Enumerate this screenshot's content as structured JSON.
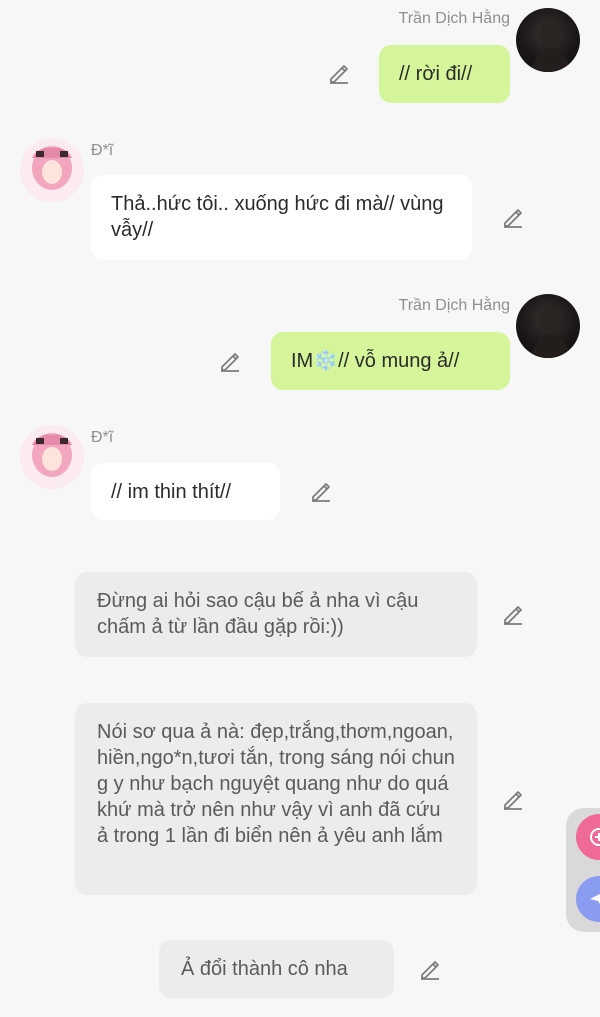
{
  "messages": [
    {
      "role": "me",
      "name": "Trần Dịch Hằng",
      "text": "// rời đi//"
    },
    {
      "role": "them",
      "name": "Đ*ĩ",
      "text": "Thả..hức tôi.. xuống hức đi mà// vùng vẫy//"
    },
    {
      "role": "me",
      "name": "Trần Dịch Hằng",
      "prefix": "IM",
      "emoji": "❄️",
      "text": "// vỗ mung ả//"
    },
    {
      "role": "them",
      "name": "Đ*ĩ",
      "text": "// im thin thít//"
    },
    {
      "role": "narration",
      "text": "Đừng ai hỏi sao cậu bế ả nha vì cậu chấm ả từ lần đầu gặp rồi:))"
    },
    {
      "role": "narration",
      "text": "Nói sơ qua ả nà: đẹp,trắng,thơm,ngoan,hiền,ngo*n,tươi tắn, trong sáng nói chung y như bạch nguyệt quang như do quá khứ mà trở nên như vậy vì anh đã cứu ả trong 1 lần đi biển nên ả yêu anh lắm"
    },
    {
      "role": "narration",
      "text": "Ả đổi thành cô nha"
    }
  ],
  "colors": {
    "my_bubble": "#d5f59a",
    "their_bubble": "#ffffff",
    "narration_bubble": "#ececec",
    "background": "#f7f7f7",
    "fab_pink": "#f06a98",
    "fab_blue": "#8a9cf0"
  },
  "icons": {
    "edit": "pencil-icon",
    "fab_top": "plus-circle-icon",
    "fab_bottom": "send-icon"
  }
}
